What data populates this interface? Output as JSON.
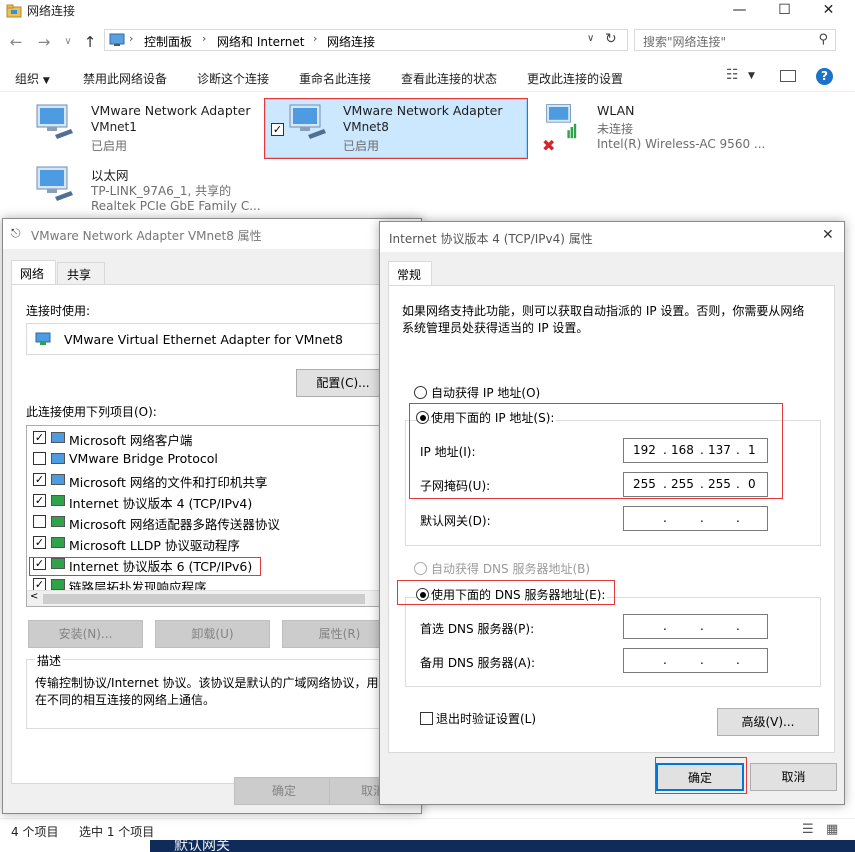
{
  "window": {
    "title": "网络连接",
    "controls": [
      "minimize",
      "maximize",
      "close"
    ]
  },
  "nav": {
    "breadcrumb": [
      "控制面板",
      "网络和 Internet",
      "网络连接"
    ],
    "search_placeholder": "搜索\"网络连接\""
  },
  "commands": [
    "组织",
    "禁用此网络设备",
    "诊断这个连接",
    "重命名此连接",
    "查看此连接的状态",
    "更改此连接的设置"
  ],
  "adapters": [
    {
      "name": "VMware Network Adapter",
      "device": "VMnet1",
      "status": "已启用"
    },
    {
      "name": "VMware Network Adapter",
      "device": "VMnet8",
      "status": "已启用",
      "selected": true
    },
    {
      "name": "WLAN",
      "device": "未连接",
      "status": "Intel(R) Wireless-AC 9560 ..."
    },
    {
      "name": "以太网",
      "device": "TP-LINK_97A6_1, 共享的",
      "status": "Realtek PCIe GbE Family C..."
    }
  ],
  "status_bar": {
    "items": "4 个项目",
    "selected": "选中 1 个项目"
  },
  "bottom_strip_text": "默认网关",
  "props_dialog": {
    "title": "VMware Network Adapter VMnet8 属性",
    "tabs": [
      "网络",
      "共享"
    ],
    "connect_using_label": "连接时使用:",
    "adapter_name": "VMware Virtual Ethernet Adapter for VMnet8",
    "configure_button": "配置(C)...",
    "items_label": "此连接使用下列项目(O):",
    "items": [
      {
        "label": "Microsoft 网络客户端",
        "checked": true
      },
      {
        "label": "VMware Bridge Protocol",
        "checked": false
      },
      {
        "label": "Microsoft 网络的文件和打印机共享",
        "checked": true
      },
      {
        "label": "Internet 协议版本 4 (TCP/IPv4)",
        "checked": true
      },
      {
        "label": "Microsoft 网络适配器多路传送器协议",
        "checked": false
      },
      {
        "label": "Microsoft LLDP 协议驱动程序",
        "checked": true
      },
      {
        "label": "Internet 协议版本 6 (TCP/IPv6)",
        "checked": true
      },
      {
        "label": "链路层拓扑发现响应程序",
        "checked": true
      }
    ],
    "install_button": "安装(N)...",
    "uninstall_button": "卸载(U)",
    "properties_button": "属性(R)",
    "description_label": "描述",
    "description_text": "传输控制协议/Internet 协议。该协议是默认的广域网络协议，用于在不同的相互连接的网络上通信。",
    "ok_button": "确定",
    "cancel_button": "取消"
  },
  "ipv4_dialog": {
    "title": "Internet 协议版本 4 (TCP/IPv4) 属性",
    "tab": "常规",
    "intro": "如果网络支持此功能，则可以获取自动指派的 IP 设置。否则，你需要从网络系统管理员处获得适当的 IP 设置。",
    "auto_ip_label": "自动获得 IP 地址(O)",
    "manual_ip_label": "使用下面的 IP 地址(S):",
    "ip_label": "IP 地址(I):",
    "ip_value": [
      "192",
      "168",
      "137",
      "1"
    ],
    "mask_label": "子网掩码(U):",
    "mask_value": [
      "255",
      "255",
      "255",
      "0"
    ],
    "gateway_label": "默认网关(D):",
    "auto_dns_label": "自动获得 DNS 服务器地址(B)",
    "manual_dns_label": "使用下面的 DNS 服务器地址(E):",
    "preferred_dns_label": "首选 DNS 服务器(P):",
    "alternate_dns_label": "备用 DNS 服务器(A):",
    "validate_label": "退出时验证设置(L)",
    "advanced_button": "高级(V)...",
    "ok_button": "确定",
    "cancel_button": "取消"
  }
}
